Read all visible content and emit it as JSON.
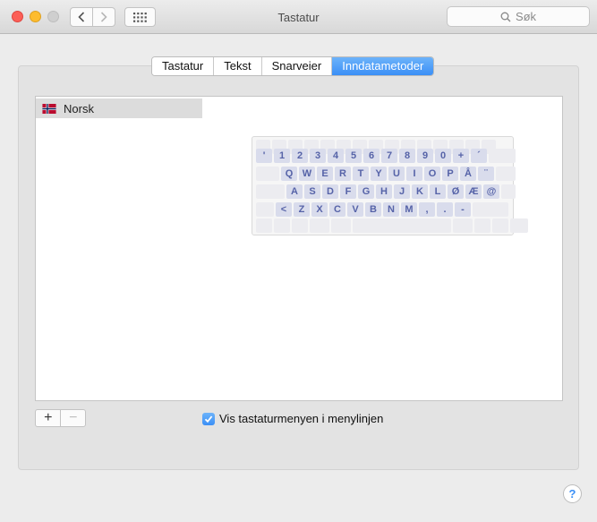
{
  "window": {
    "title": "Tastatur"
  },
  "toolbar": {
    "search_placeholder": "Søk",
    "back_icon": "chevron-left-icon",
    "forward_icon": "chevron-right-icon",
    "grid_icon": "grid-icon"
  },
  "tabs": [
    {
      "label": "Tastatur",
      "selected": false
    },
    {
      "label": "Tekst",
      "selected": false
    },
    {
      "label": "Snarveier",
      "selected": false
    },
    {
      "label": "Inndatametoder",
      "selected": true
    }
  ],
  "input_sources": [
    {
      "label": "Norsk",
      "flag": "norway-flag-icon"
    }
  ],
  "keyboard": {
    "rows": [
      [
        "'",
        "1",
        "2",
        "3",
        "4",
        "5",
        "6",
        "7",
        "8",
        "9",
        "0",
        "+",
        "´"
      ],
      [
        "Q",
        "W",
        "E",
        "R",
        "T",
        "Y",
        "U",
        "I",
        "O",
        "P",
        "Å",
        "¨"
      ],
      [
        "A",
        "S",
        "D",
        "F",
        "G",
        "H",
        "J",
        "K",
        "L",
        "Ø",
        "Æ",
        "@"
      ],
      [
        "<",
        "Z",
        "X",
        "C",
        "V",
        "B",
        "N",
        "M",
        ",",
        ".",
        "-"
      ]
    ]
  },
  "buttons": {
    "add": "+",
    "remove": "−"
  },
  "options": {
    "show_menu_label": "Vis tastaturmenyen i menylinjen",
    "show_menu_checked": true
  },
  "help": {
    "label": "?"
  },
  "colors": {
    "accent": "#3b8ff6",
    "key_text": "#5663a8"
  }
}
